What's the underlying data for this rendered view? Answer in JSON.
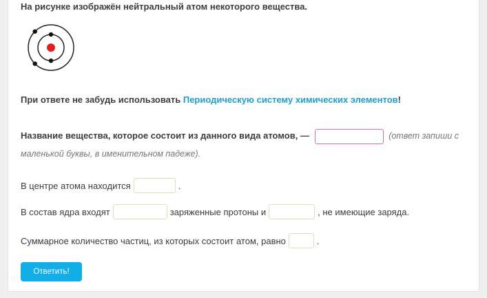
{
  "task": {
    "intro": "На рисунке изображён нейтральный атом некоторого вещества.",
    "hint_prefix": "При ответе не забудь использовать ",
    "hint_link": "Периодическую систему химических элементов",
    "hint_suffix": "!",
    "q1_text": "Название вещества, которое состоит из данного вида атомов, —",
    "q1_note": "(ответ запиши с маленькой буквы, в именительном падеже).",
    "q2_prefix": "В центре атома находится",
    "q2_suffix": ".",
    "q3_prefix": "В состав ядра входят",
    "q3_middle": "заряженные протоны и",
    "q3_suffix": ", не имеющие заряда.",
    "q4_prefix": "Суммарное количество частиц, из которых состоит атом, равно",
    "q4_suffix": "."
  },
  "inputs": {
    "substance": "",
    "center": "",
    "proton_charge": "",
    "neutrons": "",
    "total": ""
  },
  "submit_label": "Ответить!",
  "colors": {
    "link": "#1a9fcf",
    "button": "#11aee8",
    "nucleus": "#e02020",
    "active_border": "#e46da0",
    "input_border": "#d6e3b6"
  }
}
